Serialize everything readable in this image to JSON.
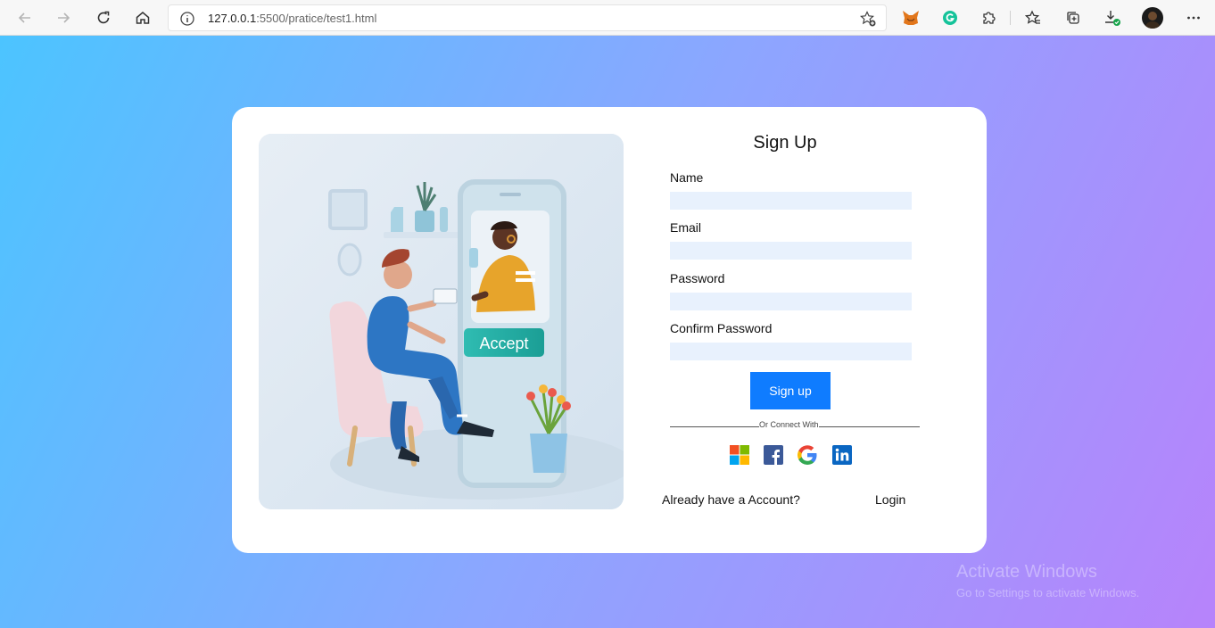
{
  "browser": {
    "url_host": "127.0.0.1",
    "url_rest": ":5500/pratice/test1.html"
  },
  "signup": {
    "title": "Sign Up",
    "fields": [
      {
        "label": "Name",
        "value": ""
      },
      {
        "label": "Email",
        "value": ""
      },
      {
        "label": "Password",
        "value": ""
      },
      {
        "label": "Confirm Password",
        "value": ""
      }
    ],
    "submit_label": "Sign up",
    "divider_text": "Or Connect With",
    "social_icons": [
      "microsoft-icon",
      "facebook-icon",
      "google-icon",
      "linkedin-icon"
    ],
    "account_prompt": "Already have a Account?",
    "login_label": "Login"
  },
  "illustration": {
    "button_text": "Accept"
  },
  "watermark": {
    "title": "Activate Windows",
    "subtitle": "Go to Settings to activate Windows."
  },
  "colors": {
    "gradient_start": "#4cc4ff",
    "gradient_end": "#b783fb",
    "primary_button": "#0f7cff",
    "input_bg": "#e8f1fd"
  }
}
